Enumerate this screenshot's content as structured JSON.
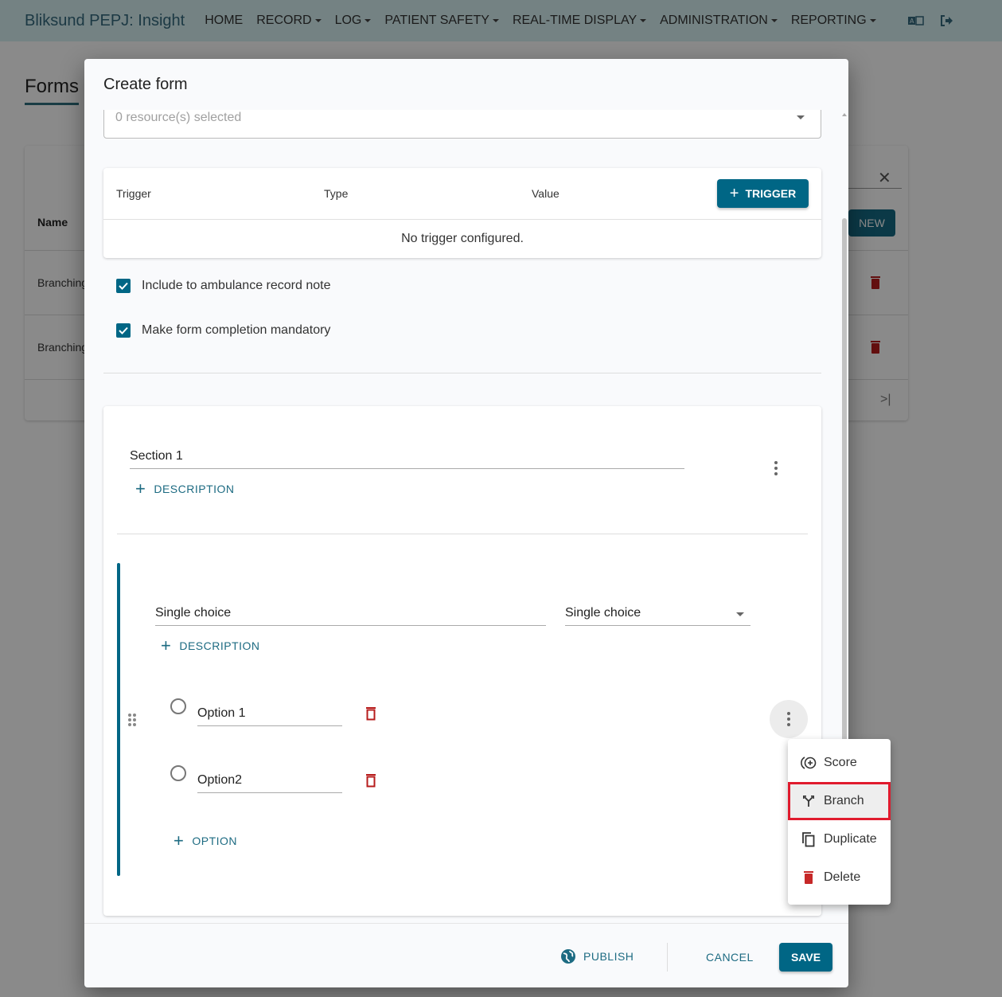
{
  "navbar": {
    "brand": "Bliksund PEPJ: Insight",
    "items": [
      {
        "label": "HOME",
        "dropdown": false
      },
      {
        "label": "RECORD",
        "dropdown": true
      },
      {
        "label": "LOG",
        "dropdown": true
      },
      {
        "label": "PATIENT SAFETY",
        "dropdown": true
      },
      {
        "label": "REAL-TIME DISPLAY",
        "dropdown": true
      },
      {
        "label": "ADMINISTRATION",
        "dropdown": true
      },
      {
        "label": "REPORTING",
        "dropdown": true
      }
    ],
    "icons": [
      "translate-icon",
      "logout-icon"
    ]
  },
  "background_page": {
    "title": "Forms",
    "table": {
      "column_name": "Name",
      "rows": [
        "Branching",
        "Branching"
      ],
      "new_button": "NEW",
      "last_page_icon": ">|"
    }
  },
  "modal": {
    "title": "Create form",
    "resource_select": {
      "placeholder": "0 resource(s) selected"
    },
    "triggers": {
      "columns": [
        "Trigger",
        "Type",
        "Value"
      ],
      "add_button": "TRIGGER",
      "empty_message": "No trigger configured."
    },
    "checkboxes": [
      {
        "label": "Include to ambulance record note",
        "checked": true
      },
      {
        "label": "Make form completion mandatory",
        "checked": true
      }
    ],
    "section": {
      "title": "Section 1",
      "add_description": "DESCRIPTION",
      "question": {
        "title": "Single choice",
        "type": "Single choice",
        "add_description": "DESCRIPTION",
        "options": [
          "Option 1",
          "Option2"
        ],
        "add_option": "OPTION"
      }
    },
    "footer": {
      "publish": "PUBLISH",
      "cancel": "CANCEL",
      "save": "SAVE"
    }
  },
  "context_menu": {
    "items": [
      {
        "label": "Score",
        "icon": "score-icon"
      },
      {
        "label": "Branch",
        "icon": "branch-icon",
        "highlighted": true
      },
      {
        "label": "Duplicate",
        "icon": "duplicate-icon"
      },
      {
        "label": "Delete",
        "icon": "delete-icon"
      }
    ]
  },
  "colors": {
    "primary": "#006685",
    "danger": "#b71c1c",
    "highlight_outline": "#e01b2e"
  }
}
